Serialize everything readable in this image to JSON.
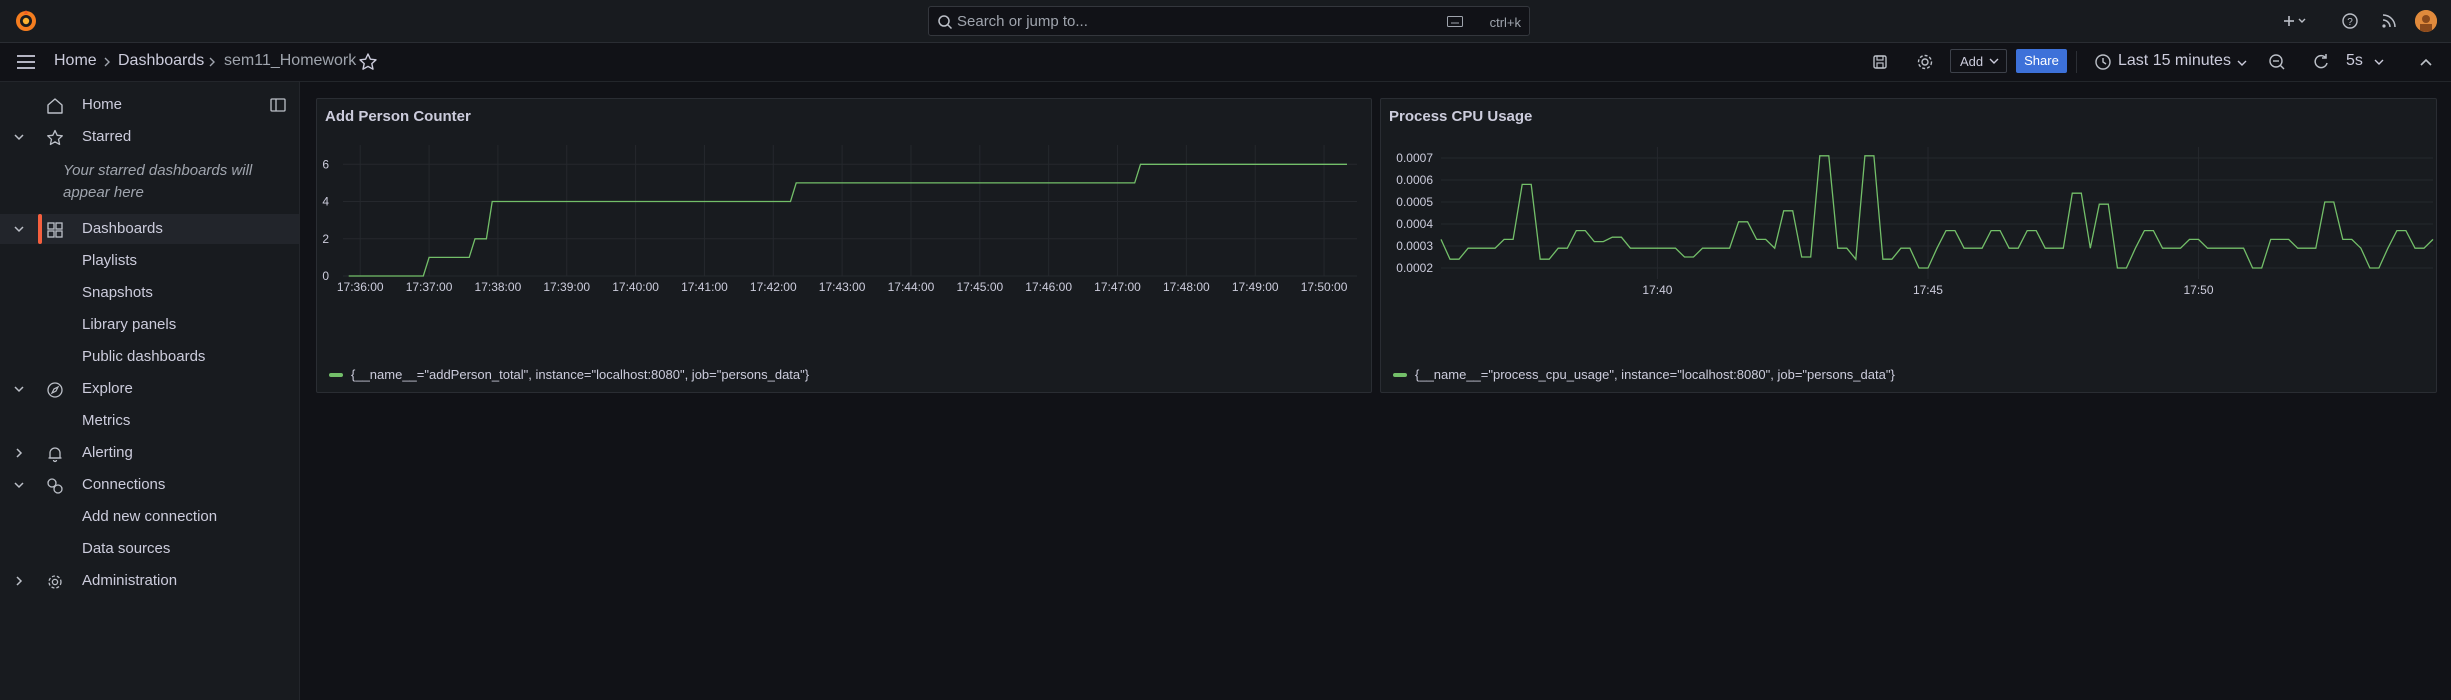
{
  "topbar": {
    "search_placeholder": "Search or jump to...",
    "search_shortcut": "ctrl+k"
  },
  "breadcrumb": [
    "Home",
    "Dashboards",
    "sem11_Homework"
  ],
  "toolbar": {
    "add_label": "Add",
    "share_label": "Share",
    "time_range": "Last 15 minutes",
    "refresh_interval": "5s"
  },
  "sidebar": {
    "items": [
      {
        "label": "Home",
        "icon": "home-icon"
      },
      {
        "label": "Starred",
        "icon": "star-icon",
        "expanded": true
      },
      {
        "label": "Dashboards",
        "icon": "apps-icon",
        "expanded": true,
        "active": true
      },
      {
        "label": "Playlists"
      },
      {
        "label": "Snapshots"
      },
      {
        "label": "Library panels"
      },
      {
        "label": "Public dashboards"
      },
      {
        "label": "Explore",
        "icon": "compass-icon",
        "expanded": true
      },
      {
        "label": "Metrics"
      },
      {
        "label": "Alerting",
        "icon": "bell-icon",
        "expanded": false
      },
      {
        "label": "Connections",
        "icon": "connections-icon",
        "expanded": true
      },
      {
        "label": "Add new connection"
      },
      {
        "label": "Data sources"
      },
      {
        "label": "Administration",
        "icon": "gear-icon",
        "expanded": false
      }
    ],
    "starred_note": "Your starred dashboards will appear here"
  },
  "colors": {
    "accent": "#f55f3e",
    "series": "#73bf69",
    "share": "#3d71d9"
  },
  "chart_data": [
    {
      "type": "line",
      "title": "Add Person Counter",
      "x_ticks": [
        "17:36:00",
        "17:37:00",
        "17:38:00",
        "17:39:00",
        "17:40:00",
        "17:41:00",
        "17:42:00",
        "17:43:00",
        "17:44:00",
        "17:45:00",
        "17:46:00",
        "17:47:00",
        "17:48:00",
        "17:49:00",
        "17:50:00"
      ],
      "y_ticks": [
        0,
        2,
        4,
        6
      ],
      "ylim": [
        0,
        6.5
      ],
      "series": [
        {
          "name": "{__name__=\"addPerson_total\", instance=\"localhost:8080\", job=\"persons_data\"}",
          "x": [
            "17:35:50",
            "17:36:55",
            "17:37:00",
            "17:37:35",
            "17:37:40",
            "17:37:50",
            "17:37:55",
            "17:42:15",
            "17:42:20",
            "17:47:15",
            "17:47:20",
            "17:50:20"
          ],
          "y": [
            0,
            0,
            1,
            1,
            2,
            2,
            4,
            4,
            5,
            5,
            6,
            6
          ]
        }
      ]
    },
    {
      "type": "line",
      "title": "Process CPU Usage",
      "x_ticks": [
        "17:40",
        "17:45",
        "17:50"
      ],
      "y_ticks": [
        0.0002,
        0.0003,
        0.0004,
        0.0005,
        0.0006,
        0.0007
      ],
      "ylim": [
        0.00015,
        0.00075
      ],
      "series": [
        {
          "name": "{__name__=\"process_cpu_usage\", instance=\"localhost:8080\", job=\"persons_data\"}",
          "x_start": "17:36:00",
          "step_seconds": 10,
          "values": [
            0.00033,
            0.00024,
            0.00024,
            0.00029,
            0.00029,
            0.00029,
            0.00029,
            0.00033,
            0.00033,
            0.00058,
            0.00058,
            0.00024,
            0.00024,
            0.00029,
            0.00029,
            0.00037,
            0.00037,
            0.00032,
            0.00032,
            0.00034,
            0.00034,
            0.00029,
            0.00029,
            0.00029,
            0.00029,
            0.00029,
            0.00029,
            0.00025,
            0.00025,
            0.00029,
            0.00029,
            0.00029,
            0.00029,
            0.00041,
            0.00041,
            0.00033,
            0.00033,
            0.00029,
            0.00046,
            0.00046,
            0.00025,
            0.00025,
            0.00071,
            0.00071,
            0.00029,
            0.00029,
            0.00024,
            0.00071,
            0.00071,
            0.00024,
            0.00024,
            0.00029,
            0.00029,
            0.0002,
            0.0002,
            0.00029,
            0.00037,
            0.00037,
            0.00029,
            0.00029,
            0.00029,
            0.00037,
            0.00037,
            0.00029,
            0.00029,
            0.00037,
            0.00037,
            0.00029,
            0.00029,
            0.00029,
            0.00054,
            0.00054,
            0.00029,
            0.00049,
            0.00049,
            0.0002,
            0.0002,
            0.00029,
            0.00037,
            0.00037,
            0.00029,
            0.00029,
            0.00029,
            0.00033,
            0.00033,
            0.00029,
            0.00029,
            0.00029,
            0.00029,
            0.00029,
            0.0002,
            0.0002,
            0.00033,
            0.00033,
            0.00033,
            0.00029,
            0.00029,
            0.00029,
            0.0005,
            0.0005,
            0.00033,
            0.00033,
            0.00029,
            0.0002,
            0.0002,
            0.00029,
            0.00037,
            0.00037,
            0.00029,
            0.00029,
            0.00033
          ]
        }
      ]
    }
  ]
}
